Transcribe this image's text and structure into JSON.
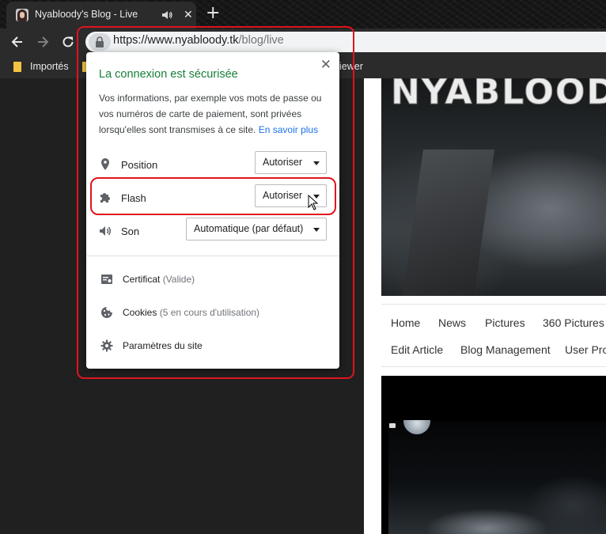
{
  "browser": {
    "tab": {
      "title": "Nyabloody's Blog - Live",
      "close": "✕"
    },
    "new_tab": "+",
    "url": {
      "host": "https://www.nyabloody.tk",
      "path": "/blog/live"
    },
    "bookmarks": [
      {
        "label": "Importés"
      },
      {
        "label": "iewer"
      }
    ]
  },
  "site_info_popup": {
    "close": "✕",
    "title": "La connexion est sécurisée",
    "description": "Vos informations, par exemple vos mots de passe ou vos numéros de carte de paiement, sont privées lorsqu'elles sont transmises à ce site.",
    "learn_more": "En savoir plus",
    "permissions": [
      {
        "icon": "location-pin-icon",
        "label": "Position",
        "value": "Autoriser"
      },
      {
        "icon": "puzzle-plugin-icon",
        "label": "Flash",
        "value": "Autoriser"
      },
      {
        "icon": "speaker-icon",
        "label": "Son",
        "value": "Automatique (par défaut)"
      }
    ],
    "info_items": [
      {
        "icon": "certificate-icon",
        "label": "Certificat",
        "detail": "(Valide)"
      },
      {
        "icon": "cookie-icon",
        "label": "Cookies",
        "detail": "(5 en cours d'utilisation)"
      },
      {
        "icon": "gear-icon",
        "label": "Paramètres du site",
        "detail": ""
      }
    ]
  },
  "page": {
    "logo_text": "NYABLOODY",
    "nav": [
      "Home",
      "News",
      "Pictures",
      "360 Pictures",
      "Edit Article",
      "Blog Management",
      "User Pro"
    ]
  },
  "colors": {
    "secure_green": "#188038",
    "link_blue": "#1a73e8",
    "highlight_red": "#e0141c",
    "chrome_dark": "#2b2b2b"
  }
}
